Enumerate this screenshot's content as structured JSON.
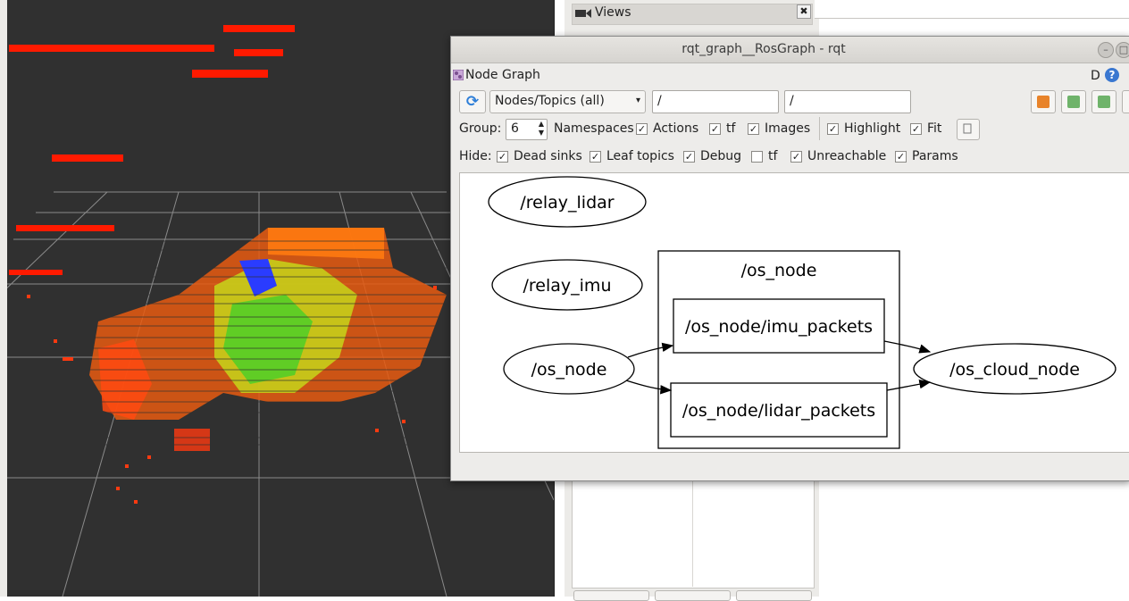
{
  "views_panel": {
    "title": "Views",
    "close_glyph": "✖"
  },
  "rqt_window": {
    "title": "rqt_graph__RosGraph - rqt",
    "plugin_title": "Node Graph",
    "d_label": "D",
    "help_glyph": "?",
    "refresh_glyph": "⟳",
    "graph_type": "Nodes/Topics (all)",
    "dropdown_arrow": "▾",
    "namespace_filter": "/",
    "topic_filter": "/",
    "group_row": {
      "label": "Group:",
      "value": "6",
      "options": [
        {
          "label": "Namespaces",
          "checked": false
        },
        {
          "label": "Actions",
          "checked": true
        },
        {
          "label": "tf",
          "checked": true
        },
        {
          "label": "Images",
          "checked": true
        },
        {
          "label": "Highlight",
          "checked": true
        },
        {
          "label": "Fit",
          "checked": true
        }
      ]
    },
    "hide_row": {
      "label": "Hide:",
      "options": [
        {
          "label": "Dead sinks",
          "checked": true
        },
        {
          "label": "Leaf topics",
          "checked": true
        },
        {
          "label": "Debug",
          "checked": true
        },
        {
          "label": "tf",
          "checked": false
        },
        {
          "label": "Unreachable",
          "checked": true
        },
        {
          "label": "Params",
          "checked": true
        }
      ]
    },
    "graph": {
      "nodes": {
        "relay_lidar": "/relay_lidar",
        "relay_imu": "/relay_imu",
        "os_node": "/os_node",
        "os_cloud_node": "/os_cloud_node"
      },
      "group_label": "/os_node",
      "topics": {
        "imu_packets": "/os_node/imu_packets",
        "lidar_packets": "/os_node/lidar_packets"
      }
    }
  },
  "colors": {
    "viewport_bg": "#303030",
    "grid_line": "#8a8a8a",
    "refresh_icon": "#2f7fd8",
    "help_icon": "#3a77d0"
  },
  "icons": [
    "views-camera-icon",
    "close-icon",
    "node-graph-plugin-icon",
    "help-icon",
    "refresh-icon",
    "load-dot-icon",
    "save-dot-icon",
    "save-svg-icon",
    "save-image-icon",
    "fit-icon",
    "minimize-icon",
    "maximize-icon"
  ]
}
